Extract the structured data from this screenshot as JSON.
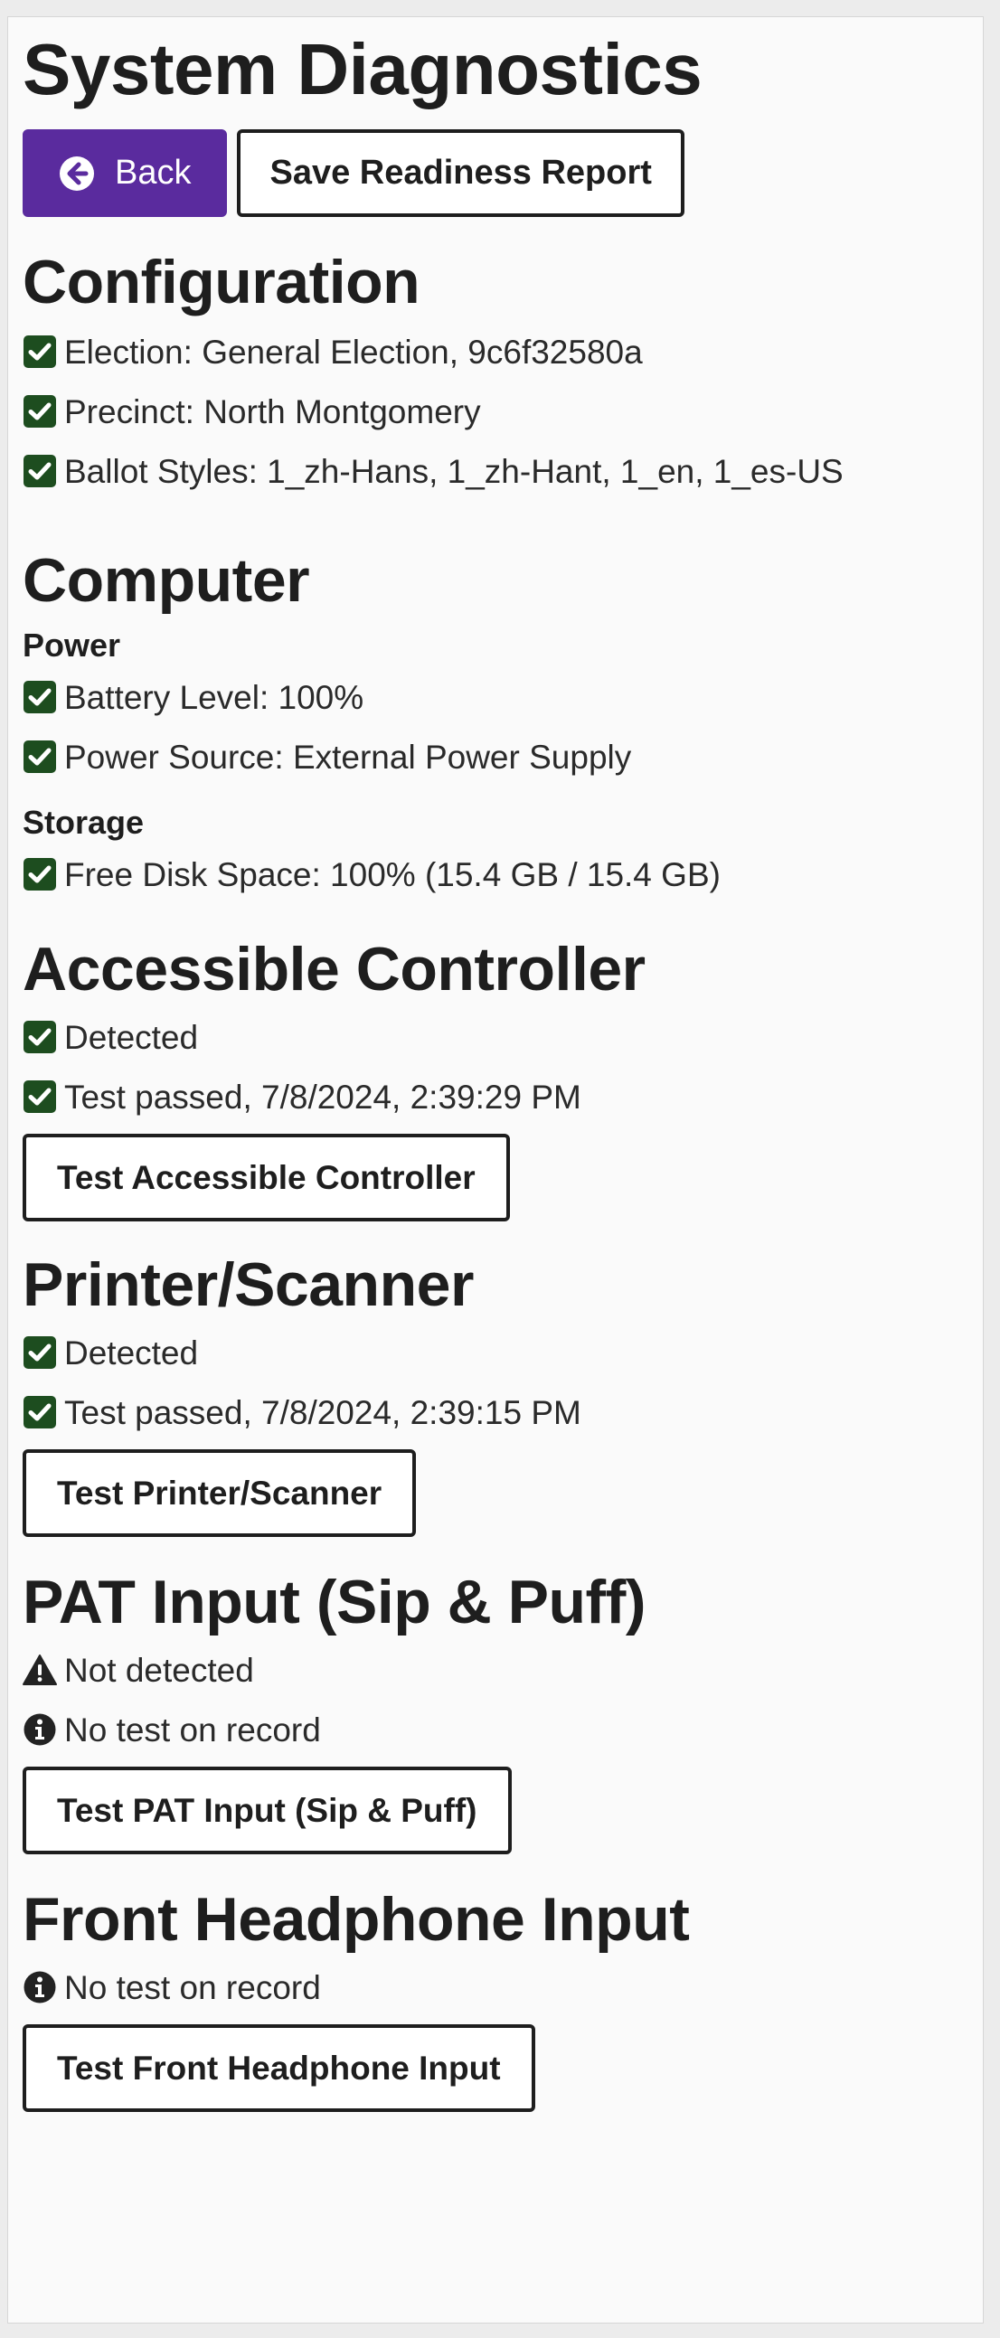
{
  "title": "System Diagnostics",
  "toolbar": {
    "back_label": "Back",
    "save_label": "Save Readiness Report"
  },
  "colors": {
    "primary": "#5a2b9e",
    "check": "#1d4d1f",
    "text": "#1e1e1e"
  },
  "configuration": {
    "heading": "Configuration",
    "items": [
      {
        "icon": "check-icon",
        "text": "Election: General Election, 9c6f32580a"
      },
      {
        "icon": "check-icon",
        "text": "Precinct: North Montgomery"
      },
      {
        "icon": "check-icon",
        "text": "Ballot Styles: 1_zh-Hans, 1_zh-Hant, 1_en, 1_es-US"
      }
    ]
  },
  "computer": {
    "heading": "Computer",
    "power": {
      "heading": "Power",
      "items": [
        {
          "icon": "check-icon",
          "text": "Battery Level: 100%"
        },
        {
          "icon": "check-icon",
          "text": "Power Source: External Power Supply"
        }
      ]
    },
    "storage": {
      "heading": "Storage",
      "items": [
        {
          "icon": "check-icon",
          "text": "Free Disk Space: 100% (15.4 GB / 15.4 GB)"
        }
      ]
    }
  },
  "accessible_controller": {
    "heading": "Accessible Controller",
    "items": [
      {
        "icon": "check-icon",
        "text": "Detected"
      },
      {
        "icon": "check-icon",
        "text": "Test passed, 7/8/2024, 2:39:29 PM"
      }
    ],
    "button": "Test Accessible Controller"
  },
  "printer_scanner": {
    "heading": "Printer/Scanner",
    "items": [
      {
        "icon": "check-icon",
        "text": "Detected"
      },
      {
        "icon": "check-icon",
        "text": "Test passed, 7/8/2024, 2:39:15 PM"
      }
    ],
    "button": "Test Printer/Scanner"
  },
  "pat_input": {
    "heading": "PAT Input (Sip & Puff)",
    "items": [
      {
        "icon": "warning-icon",
        "text": "Not detected"
      },
      {
        "icon": "info-icon",
        "text": "No test on record"
      }
    ],
    "button": "Test PAT Input (Sip & Puff)"
  },
  "headphone_input": {
    "heading": "Front Headphone Input",
    "items": [
      {
        "icon": "info-icon",
        "text": "No test on record"
      }
    ],
    "button": "Test Front Headphone Input"
  }
}
